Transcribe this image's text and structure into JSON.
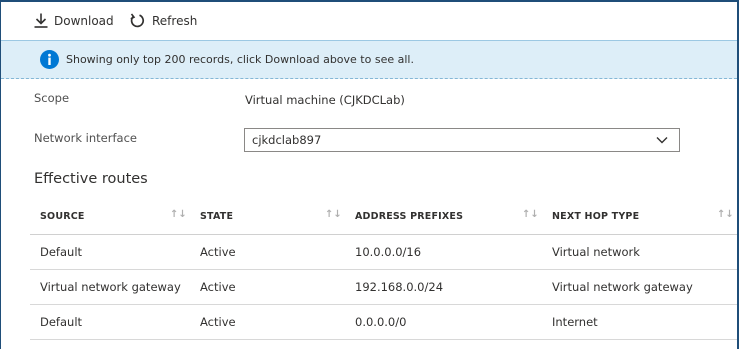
{
  "toolbar": {
    "download_label": "Download",
    "refresh_label": "Refresh"
  },
  "banner": {
    "message": "Showing only top 200 records, click Download above to see all.",
    "icon": "info-icon"
  },
  "scope": {
    "label": "Scope",
    "value": "Virtual machine (CJKDCLab)"
  },
  "network_interface": {
    "label": "Network interface",
    "selected": "cjkdclab897"
  },
  "effective_routes": {
    "title": "Effective routes",
    "columns": [
      "SOURCE",
      "STATE",
      "ADDRESS PREFIXES",
      "NEXT HOP TYPE"
    ],
    "rows": [
      [
        "Default",
        "Active",
        "10.0.0.0/16",
        "Virtual network"
      ],
      [
        "Virtual network gateway",
        "Active",
        "192.168.0.0/24",
        "Virtual network gateway"
      ],
      [
        "Default",
        "Active",
        "0.0.0.0/0",
        "Internet"
      ]
    ]
  },
  "colors": {
    "accent": "#0078d4",
    "frame": "#1f4e79",
    "banner_bg": "#ddeef8"
  }
}
